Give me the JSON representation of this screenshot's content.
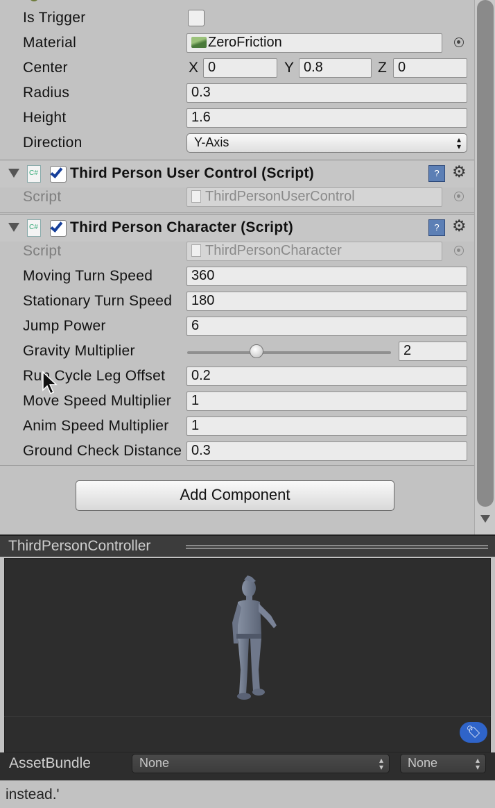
{
  "colors": {
    "panel_bg": "#c2c2c2",
    "preview_bg": "#2d2d2d",
    "toggle_checked": "#163f9a",
    "tag_button": "#2f64c9"
  },
  "collider": {
    "is_trigger": {
      "label": "Is Trigger",
      "checked": false
    },
    "material": {
      "label": "Material",
      "value": "ZeroFriction",
      "icon": "physic-material-icon"
    },
    "center": {
      "label": "Center",
      "x_label": "X",
      "x": "0",
      "y_label": "Y",
      "y": "0.8",
      "z_label": "Z",
      "z": "0"
    },
    "radius": {
      "label": "Radius",
      "value": "0.3"
    },
    "height": {
      "label": "Height",
      "value": "1.6"
    },
    "direction": {
      "label": "Direction",
      "value": "Y-Axis"
    }
  },
  "user_control": {
    "title": "Third Person User Control (Script)",
    "enabled": true,
    "script_label": "Script",
    "script_value": "ThirdPersonUserControl"
  },
  "character": {
    "title": "Third Person Character (Script)",
    "enabled": true,
    "script_label": "Script",
    "script_value": "ThirdPersonCharacter",
    "moving_turn_speed": {
      "label": "Moving Turn Speed",
      "value": "360"
    },
    "stationary_turn_speed": {
      "label": "Stationary Turn Speed",
      "value": "180"
    },
    "jump_power": {
      "label": "Jump Power",
      "value": "6"
    },
    "gravity_multiplier": {
      "label": "Gravity Multiplier",
      "value": "2",
      "slider_fraction": 0.34
    },
    "run_cycle_leg_offset": {
      "label": "Run Cycle Leg Offset",
      "value": "0.2"
    },
    "move_speed_multiplier": {
      "label": "Move Speed Multiplier",
      "value": "1"
    },
    "anim_speed_multiplier": {
      "label": "Anim Speed Multiplier",
      "value": "1"
    },
    "ground_check_distance": {
      "label": "Ground Check Distance",
      "value": "0.3"
    }
  },
  "add_component_label": "Add Component",
  "preview": {
    "title": "ThirdPersonController"
  },
  "asset_bundle": {
    "label": "AssetBundle",
    "name_value": "None",
    "variant_value": "None"
  },
  "status": {
    "text": "instead.'"
  }
}
